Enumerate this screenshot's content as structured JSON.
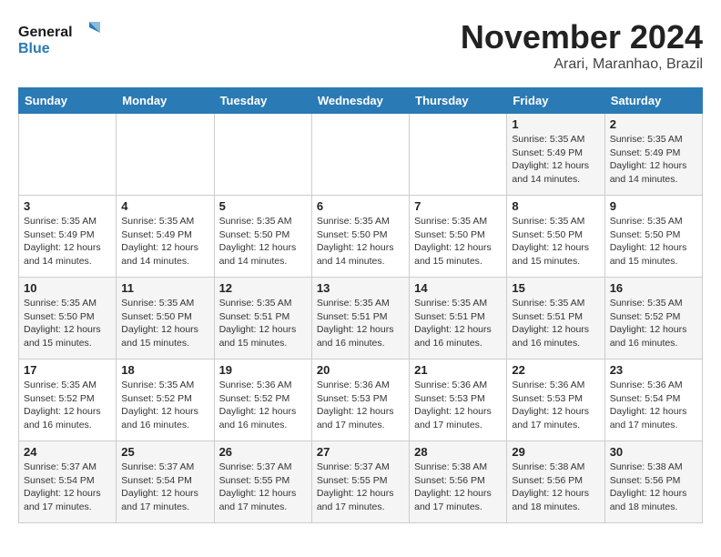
{
  "header": {
    "logo_line1": "General",
    "logo_line2": "Blue",
    "month": "November 2024",
    "location": "Arari, Maranhao, Brazil"
  },
  "weekdays": [
    "Sunday",
    "Monday",
    "Tuesday",
    "Wednesday",
    "Thursday",
    "Friday",
    "Saturday"
  ],
  "weeks": [
    [
      {
        "day": "",
        "info": ""
      },
      {
        "day": "",
        "info": ""
      },
      {
        "day": "",
        "info": ""
      },
      {
        "day": "",
        "info": ""
      },
      {
        "day": "",
        "info": ""
      },
      {
        "day": "1",
        "info": "Sunrise: 5:35 AM\nSunset: 5:49 PM\nDaylight: 12 hours\nand 14 minutes."
      },
      {
        "day": "2",
        "info": "Sunrise: 5:35 AM\nSunset: 5:49 PM\nDaylight: 12 hours\nand 14 minutes."
      }
    ],
    [
      {
        "day": "3",
        "info": "Sunrise: 5:35 AM\nSunset: 5:49 PM\nDaylight: 12 hours\nand 14 minutes."
      },
      {
        "day": "4",
        "info": "Sunrise: 5:35 AM\nSunset: 5:49 PM\nDaylight: 12 hours\nand 14 minutes."
      },
      {
        "day": "5",
        "info": "Sunrise: 5:35 AM\nSunset: 5:50 PM\nDaylight: 12 hours\nand 14 minutes."
      },
      {
        "day": "6",
        "info": "Sunrise: 5:35 AM\nSunset: 5:50 PM\nDaylight: 12 hours\nand 14 minutes."
      },
      {
        "day": "7",
        "info": "Sunrise: 5:35 AM\nSunset: 5:50 PM\nDaylight: 12 hours\nand 15 minutes."
      },
      {
        "day": "8",
        "info": "Sunrise: 5:35 AM\nSunset: 5:50 PM\nDaylight: 12 hours\nand 15 minutes."
      },
      {
        "day": "9",
        "info": "Sunrise: 5:35 AM\nSunset: 5:50 PM\nDaylight: 12 hours\nand 15 minutes."
      }
    ],
    [
      {
        "day": "10",
        "info": "Sunrise: 5:35 AM\nSunset: 5:50 PM\nDaylight: 12 hours\nand 15 minutes."
      },
      {
        "day": "11",
        "info": "Sunrise: 5:35 AM\nSunset: 5:50 PM\nDaylight: 12 hours\nand 15 minutes."
      },
      {
        "day": "12",
        "info": "Sunrise: 5:35 AM\nSunset: 5:51 PM\nDaylight: 12 hours\nand 15 minutes."
      },
      {
        "day": "13",
        "info": "Sunrise: 5:35 AM\nSunset: 5:51 PM\nDaylight: 12 hours\nand 16 minutes."
      },
      {
        "day": "14",
        "info": "Sunrise: 5:35 AM\nSunset: 5:51 PM\nDaylight: 12 hours\nand 16 minutes."
      },
      {
        "day": "15",
        "info": "Sunrise: 5:35 AM\nSunset: 5:51 PM\nDaylight: 12 hours\nand 16 minutes."
      },
      {
        "day": "16",
        "info": "Sunrise: 5:35 AM\nSunset: 5:52 PM\nDaylight: 12 hours\nand 16 minutes."
      }
    ],
    [
      {
        "day": "17",
        "info": "Sunrise: 5:35 AM\nSunset: 5:52 PM\nDaylight: 12 hours\nand 16 minutes."
      },
      {
        "day": "18",
        "info": "Sunrise: 5:35 AM\nSunset: 5:52 PM\nDaylight: 12 hours\nand 16 minutes."
      },
      {
        "day": "19",
        "info": "Sunrise: 5:36 AM\nSunset: 5:52 PM\nDaylight: 12 hours\nand 16 minutes."
      },
      {
        "day": "20",
        "info": "Sunrise: 5:36 AM\nSunset: 5:53 PM\nDaylight: 12 hours\nand 17 minutes."
      },
      {
        "day": "21",
        "info": "Sunrise: 5:36 AM\nSunset: 5:53 PM\nDaylight: 12 hours\nand 17 minutes."
      },
      {
        "day": "22",
        "info": "Sunrise: 5:36 AM\nSunset: 5:53 PM\nDaylight: 12 hours\nand 17 minutes."
      },
      {
        "day": "23",
        "info": "Sunrise: 5:36 AM\nSunset: 5:54 PM\nDaylight: 12 hours\nand 17 minutes."
      }
    ],
    [
      {
        "day": "24",
        "info": "Sunrise: 5:37 AM\nSunset: 5:54 PM\nDaylight: 12 hours\nand 17 minutes."
      },
      {
        "day": "25",
        "info": "Sunrise: 5:37 AM\nSunset: 5:54 PM\nDaylight: 12 hours\nand 17 minutes."
      },
      {
        "day": "26",
        "info": "Sunrise: 5:37 AM\nSunset: 5:55 PM\nDaylight: 12 hours\nand 17 minutes."
      },
      {
        "day": "27",
        "info": "Sunrise: 5:37 AM\nSunset: 5:55 PM\nDaylight: 12 hours\nand 17 minutes."
      },
      {
        "day": "28",
        "info": "Sunrise: 5:38 AM\nSunset: 5:56 PM\nDaylight: 12 hours\nand 17 minutes."
      },
      {
        "day": "29",
        "info": "Sunrise: 5:38 AM\nSunset: 5:56 PM\nDaylight: 12 hours\nand 18 minutes."
      },
      {
        "day": "30",
        "info": "Sunrise: 5:38 AM\nSunset: 5:56 PM\nDaylight: 12 hours\nand 18 minutes."
      }
    ]
  ]
}
